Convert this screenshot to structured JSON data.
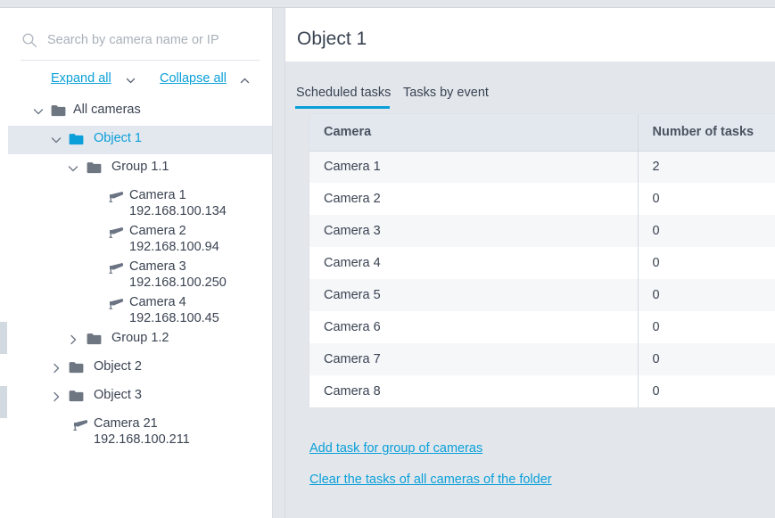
{
  "colors": {
    "accent": "#0a9fd8",
    "text": "#3a4352",
    "panel_bg": "#e3e7ec",
    "selected_row": "#e3e8ef",
    "table_header_bg": "#e3e8ef",
    "row_alt_bg": "#f5f7f9",
    "border": "#dfe3e8",
    "folder_gray": "#6e7681",
    "folder_selected": "#0a9fd8"
  },
  "sidebar": {
    "search": {
      "icon": "search-icon",
      "value": "",
      "placeholder": "Search by camera name or IP"
    },
    "expand_all_label": "Expand all",
    "collapse_all_label": "Collapse all",
    "expand_all_icon": "chevron-down-icon",
    "collapse_all_icon": "chevron-up-icon",
    "tree": [
      {
        "label": "All cameras",
        "type": "folder",
        "icon": "folder-icon",
        "chevron": "chevron-down-icon",
        "expanded": true,
        "depth": 0,
        "selected": false,
        "ip": ""
      },
      {
        "label": "Object 1",
        "type": "folder",
        "icon": "folder-icon",
        "chevron": "chevron-down-icon",
        "expanded": true,
        "depth": 1,
        "selected": true,
        "ip": ""
      },
      {
        "label": "Group 1.1",
        "type": "folder",
        "icon": "folder-icon",
        "chevron": "chevron-down-icon",
        "expanded": true,
        "depth": 2,
        "selected": false,
        "ip": ""
      },
      {
        "label": "Camera 1",
        "type": "camera",
        "icon": "camera-icon",
        "chevron": "",
        "expanded": false,
        "depth": 3,
        "selected": false,
        "ip": "192.168.100.134"
      },
      {
        "label": "Camera 2",
        "type": "camera",
        "icon": "camera-icon",
        "chevron": "",
        "expanded": false,
        "depth": 3,
        "selected": false,
        "ip": "192.168.100.94"
      },
      {
        "label": "Camera 3",
        "type": "camera",
        "icon": "camera-icon",
        "chevron": "",
        "expanded": false,
        "depth": 3,
        "selected": false,
        "ip": "192.168.100.250"
      },
      {
        "label": "Camera 4",
        "type": "camera",
        "icon": "camera-icon",
        "chevron": "",
        "expanded": false,
        "depth": 3,
        "selected": false,
        "ip": "192.168.100.45"
      },
      {
        "label": "Group 1.2",
        "type": "folder",
        "icon": "folder-icon",
        "chevron": "chevron-right-icon",
        "expanded": false,
        "depth": 2,
        "selected": false,
        "ip": ""
      },
      {
        "label": "Object 2",
        "type": "folder",
        "icon": "folder-icon",
        "chevron": "chevron-right-icon",
        "expanded": false,
        "depth": 1,
        "selected": false,
        "ip": ""
      },
      {
        "label": "Object 3",
        "type": "folder",
        "icon": "folder-icon",
        "chevron": "chevron-right-icon",
        "expanded": false,
        "depth": 1,
        "selected": false,
        "ip": ""
      },
      {
        "label": "Camera 21",
        "type": "camera",
        "icon": "camera-icon",
        "chevron": "",
        "expanded": false,
        "depth": 1,
        "selected": false,
        "ip": "192.168.100.211"
      }
    ]
  },
  "content": {
    "title": "Object 1",
    "tabs": [
      {
        "label": "Scheduled tasks",
        "active": true
      },
      {
        "label": "Tasks by event",
        "active": false
      }
    ],
    "table": {
      "columns": [
        "Camera",
        "Number of tasks"
      ],
      "rows": [
        {
          "camera": "Camera 1",
          "tasks": "2"
        },
        {
          "camera": "Camera 2",
          "tasks": "0"
        },
        {
          "camera": "Camera 3",
          "tasks": "0"
        },
        {
          "camera": "Camera 4",
          "tasks": "0"
        },
        {
          "camera": "Camera 5",
          "tasks": "0"
        },
        {
          "camera": "Camera 6",
          "tasks": "0"
        },
        {
          "camera": "Camera 7",
          "tasks": "0"
        },
        {
          "camera": "Camera 8",
          "tasks": "0"
        }
      ]
    },
    "actions": [
      {
        "label": "Add task for group of cameras"
      },
      {
        "label": "Clear the tasks of all cameras of the folder"
      }
    ]
  }
}
